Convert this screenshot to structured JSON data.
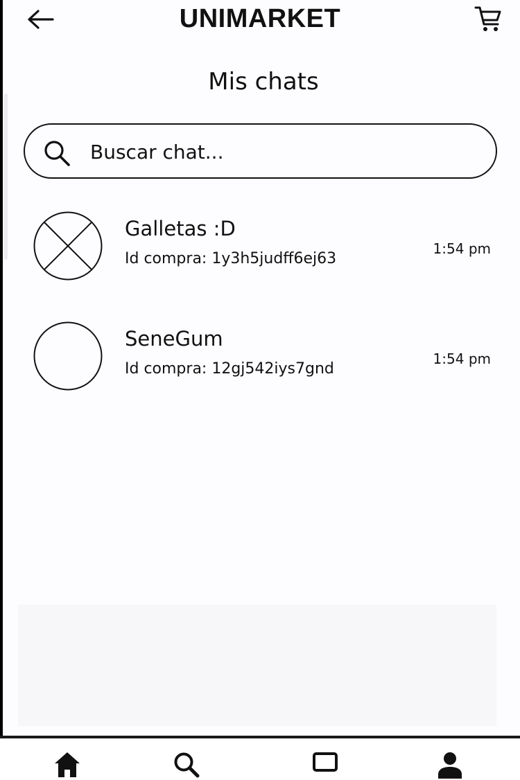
{
  "header": {
    "title": "UNIMARKET",
    "back_icon": "arrow-left-icon",
    "cart_icon": "shopping-cart-icon"
  },
  "page": {
    "title": "Mis chats"
  },
  "search": {
    "placeholder": "Buscar chat...",
    "value": "",
    "icon": "search-icon"
  },
  "chats": [
    {
      "name": "Galletas :D",
      "purchase_id": "Id compra: 1y3h5judff6ej63",
      "time": "1:54 pm",
      "avatar": "image-placeholder-icon"
    },
    {
      "name": "SeneGum",
      "purchase_id": "Id compra:  12gj542iys7gnd",
      "time": "1:54 pm",
      "avatar": "empty-avatar-circle"
    }
  ],
  "bottom_nav": {
    "items": [
      "home-icon",
      "search-icon",
      "square-icon",
      "user-icon"
    ]
  },
  "colors": {
    "background": "#fdfcff",
    "foreground": "#111111",
    "nav_background": "#ffffff"
  }
}
